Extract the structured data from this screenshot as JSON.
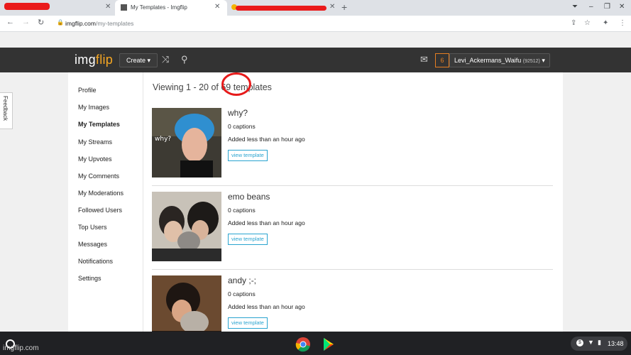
{
  "browser": {
    "tabs": [
      {
        "title": "",
        "redacted": true
      },
      {
        "title": "My Templates - Imgflip",
        "active": true
      },
      {
        "title": "",
        "redacted": true
      }
    ],
    "new_tab_icon": "plus-icon",
    "url_host": "imgflip.com",
    "url_path": "/my-templates"
  },
  "site": {
    "logo_main": "img",
    "logo_accent": "flip",
    "create_label": "Create ▾",
    "notification_count": "6",
    "username": "Levi_Ackermans_Waifu",
    "points": "(92512)",
    "feedback_label": "Feedback"
  },
  "sidebar": {
    "items": [
      {
        "label": "Profile"
      },
      {
        "label": "My Images"
      },
      {
        "label": "My Templates",
        "active": true
      },
      {
        "label": "My Streams"
      },
      {
        "label": "My Upvotes"
      },
      {
        "label": "My Comments"
      },
      {
        "label": "My Moderations"
      },
      {
        "label": "Followed Users"
      },
      {
        "label": "Top Users"
      },
      {
        "label": "Messages"
      },
      {
        "label": "Notifications"
      },
      {
        "label": "Settings"
      }
    ]
  },
  "main": {
    "viewing_text": "Viewing 1 - 20 of 69 templates",
    "templates": [
      {
        "name": "why?",
        "captions": "0 captions",
        "added": "Added less than an hour ago",
        "button": "view template",
        "thumb_text": "why?"
      },
      {
        "name": "emo beans",
        "captions": "0 captions",
        "added": "Added less than an hour ago",
        "button": "view template"
      },
      {
        "name": "andy ;-;",
        "captions": "0 captions",
        "added": "Added less than an hour ago",
        "button": "view template"
      }
    ]
  },
  "taskbar": {
    "time": "13:48",
    "watermark": "imgflip.com"
  }
}
